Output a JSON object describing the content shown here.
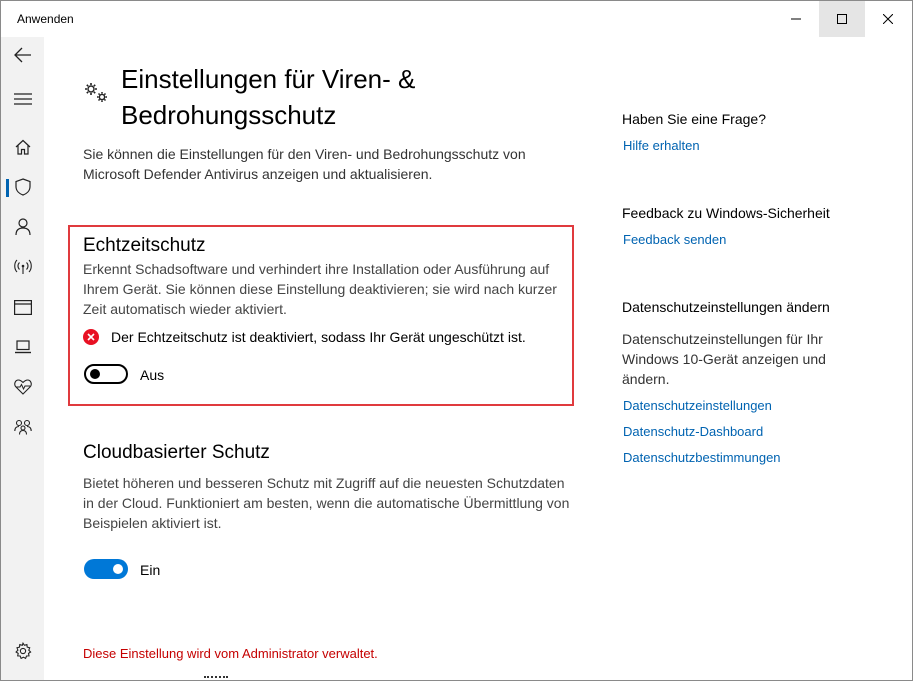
{
  "window": {
    "title": "Anwenden",
    "controls": {
      "minimize": "minimize-icon",
      "maximize": "maximize-icon",
      "close": "close-icon"
    }
  },
  "nav": {
    "items": [
      {
        "icon": "back-arrow-icon"
      },
      {
        "icon": "hamburger-menu-icon"
      },
      {
        "icon": "home-icon"
      },
      {
        "icon": "shield-icon",
        "active": true
      },
      {
        "icon": "person-icon"
      },
      {
        "icon": "wifi-antenna-icon"
      },
      {
        "icon": "app-browser-icon"
      },
      {
        "icon": "laptop-icon"
      },
      {
        "icon": "heart-pulse-icon"
      },
      {
        "icon": "family-icon"
      },
      {
        "icon": "settings-gear-icon"
      }
    ],
    "accent": "#0063b1"
  },
  "page": {
    "title": "Einstellungen für Viren- & Bedrohungsschutz",
    "intro": "Sie können die Einstellungen für den Viren- und Bedrohungsschutz von Microsoft Defender Antivirus anzeigen und aktualisieren."
  },
  "realtime": {
    "title": "Echtzeitschutz",
    "description": "Erkennt Schadsoftware und verhindert ihre Installation oder Ausführung auf Ihrem Gerät. Sie können diese Einstellung deaktivieren; sie wird nach kurzer Zeit automatisch wieder aktiviert.",
    "warning": "Der Echtzeitschutz ist deaktiviert, sodass Ihr Gerät ungeschützt ist.",
    "toggle_state": "Aus",
    "enabled": false,
    "highlight_color": "#e03a3e",
    "warning_color": "#e81123"
  },
  "cloud": {
    "title": "Cloudbasierter Schutz",
    "description": "Bietet höheren und besseren Schutz mit Zugriff auf die neuesten Schutzdaten in der Cloud. Funktioniert am besten, wenn die automatische Übermittlung von Beispielen aktiviert ist.",
    "toggle_state": "Ein",
    "enabled": true,
    "toggle_color": "#0078d7"
  },
  "admin_note": "Diese Einstellung wird vom Administrator verwaltet.",
  "sidebar": {
    "question_heading": "Haben Sie eine Frage?",
    "help_link": "Hilfe erhalten",
    "feedback_heading": "Feedback zu Windows-Sicherheit",
    "feedback_link": "Feedback senden",
    "privacy_heading": "Datenschutzeinstellungen ändern",
    "privacy_text": "Datenschutzeinstellungen für Ihr Windows 10-Gerät anzeigen und ändern.",
    "privacy_links": [
      "Datenschutzeinstellungen",
      "Datenschutz-Dashboard",
      "Datenschutzbestimmungen"
    ],
    "link_color": "#0063b1"
  }
}
